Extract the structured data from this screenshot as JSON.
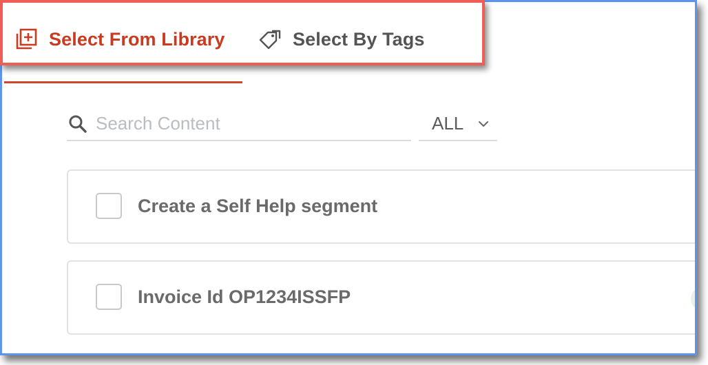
{
  "tabs": [
    {
      "label": "Select From Library",
      "icon": "library-add-icon",
      "active": true,
      "color": "#c93a1f"
    },
    {
      "label": "Select By Tags",
      "icon": "tags-icon",
      "active": false,
      "color": "#545454"
    }
  ],
  "search": {
    "placeholder": "Search Content",
    "value": ""
  },
  "filter": {
    "selected": "ALL"
  },
  "items": [
    {
      "title": "Create a Self Help segment",
      "checked": false
    },
    {
      "title": "Invoice Id OP1234ISSFP",
      "checked": false
    }
  ],
  "colors": {
    "accent": "#d2452b",
    "highlight": "#ef5d55",
    "frame": "#5b95f0"
  }
}
